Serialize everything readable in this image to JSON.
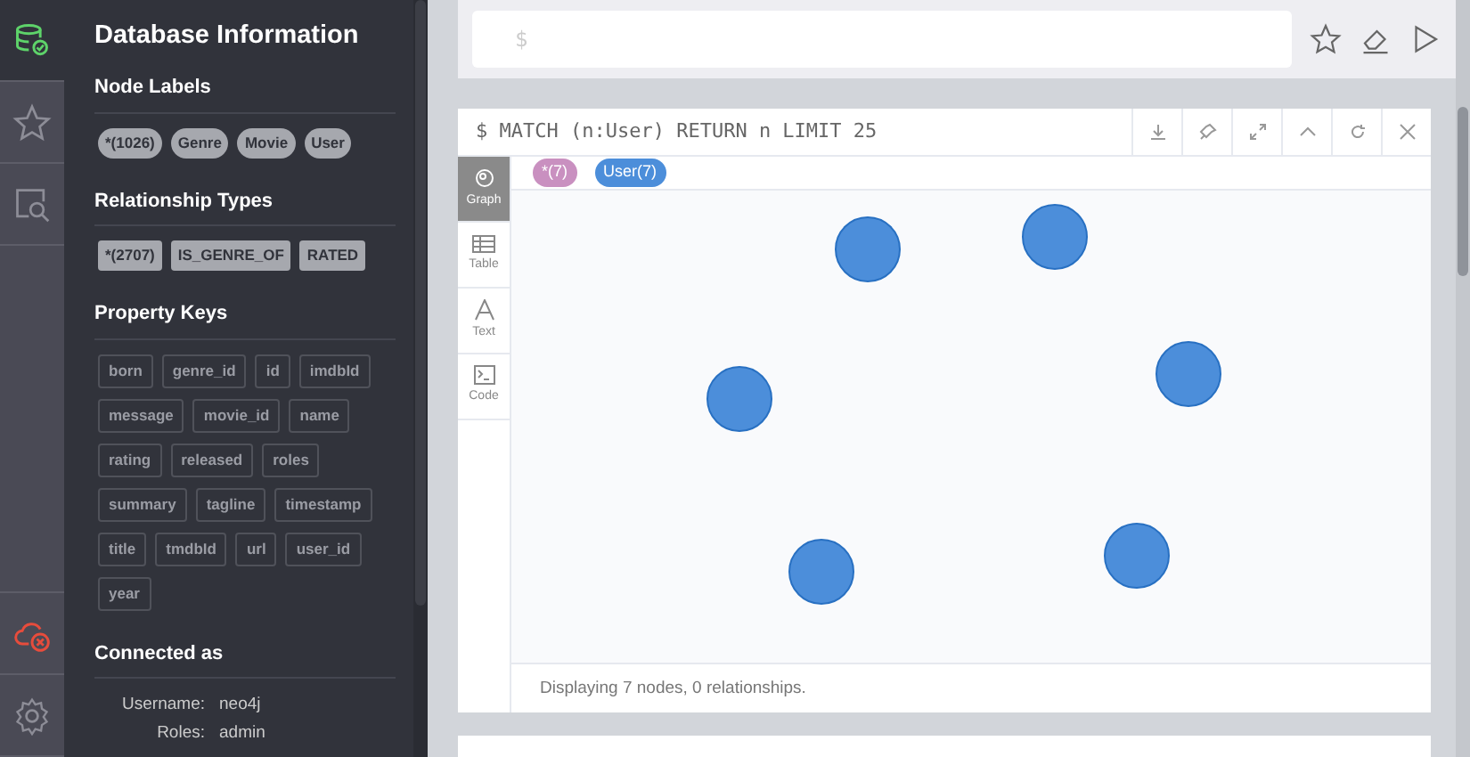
{
  "sidebar": {
    "title": "Database Information",
    "sections": [
      {
        "heading": "Node Labels",
        "kind": "pill",
        "tags": [
          "*(1026)",
          "Genre",
          "Movie",
          "User"
        ]
      },
      {
        "heading": "Relationship Types",
        "kind": "solid",
        "tags": [
          "*(2707)",
          "IS_GENRE_OF",
          "RATED"
        ]
      },
      {
        "heading": "Property Keys",
        "kind": "outline",
        "tags": [
          "born",
          "genre_id",
          "id",
          "imdbId",
          "message",
          "movie_id",
          "name",
          "rating",
          "released",
          "roles",
          "summary",
          "tagline",
          "timestamp",
          "title",
          "tmdbId",
          "url",
          "user_id",
          "year"
        ]
      }
    ],
    "connected": {
      "heading": "Connected as",
      "rows": [
        {
          "label": "Username:",
          "value": "neo4j"
        },
        {
          "label": "Roles:",
          "value": "admin"
        }
      ]
    }
  },
  "nav": [
    {
      "selected": true
    },
    {
      "selected": false
    },
    {
      "selected": false
    },
    {
      "selected": false
    },
    {
      "selected": false
    }
  ],
  "editor": {
    "prompt": "$"
  },
  "frame": {
    "query": "$ MATCH (n:User) RETURN n LIMIT 25",
    "labels": [
      {
        "text": "*(7)",
        "color": "#c990c0"
      },
      {
        "text": "User(7)",
        "color": "#4c8eda"
      }
    ],
    "views": [
      {
        "label": "Graph",
        "selected": true
      },
      {
        "label": "Table",
        "selected": false
      },
      {
        "label": "Text",
        "selected": false
      },
      {
        "label": "Code",
        "selected": false
      }
    ],
    "status": "Displaying 7 nodes, 0 relationships."
  }
}
